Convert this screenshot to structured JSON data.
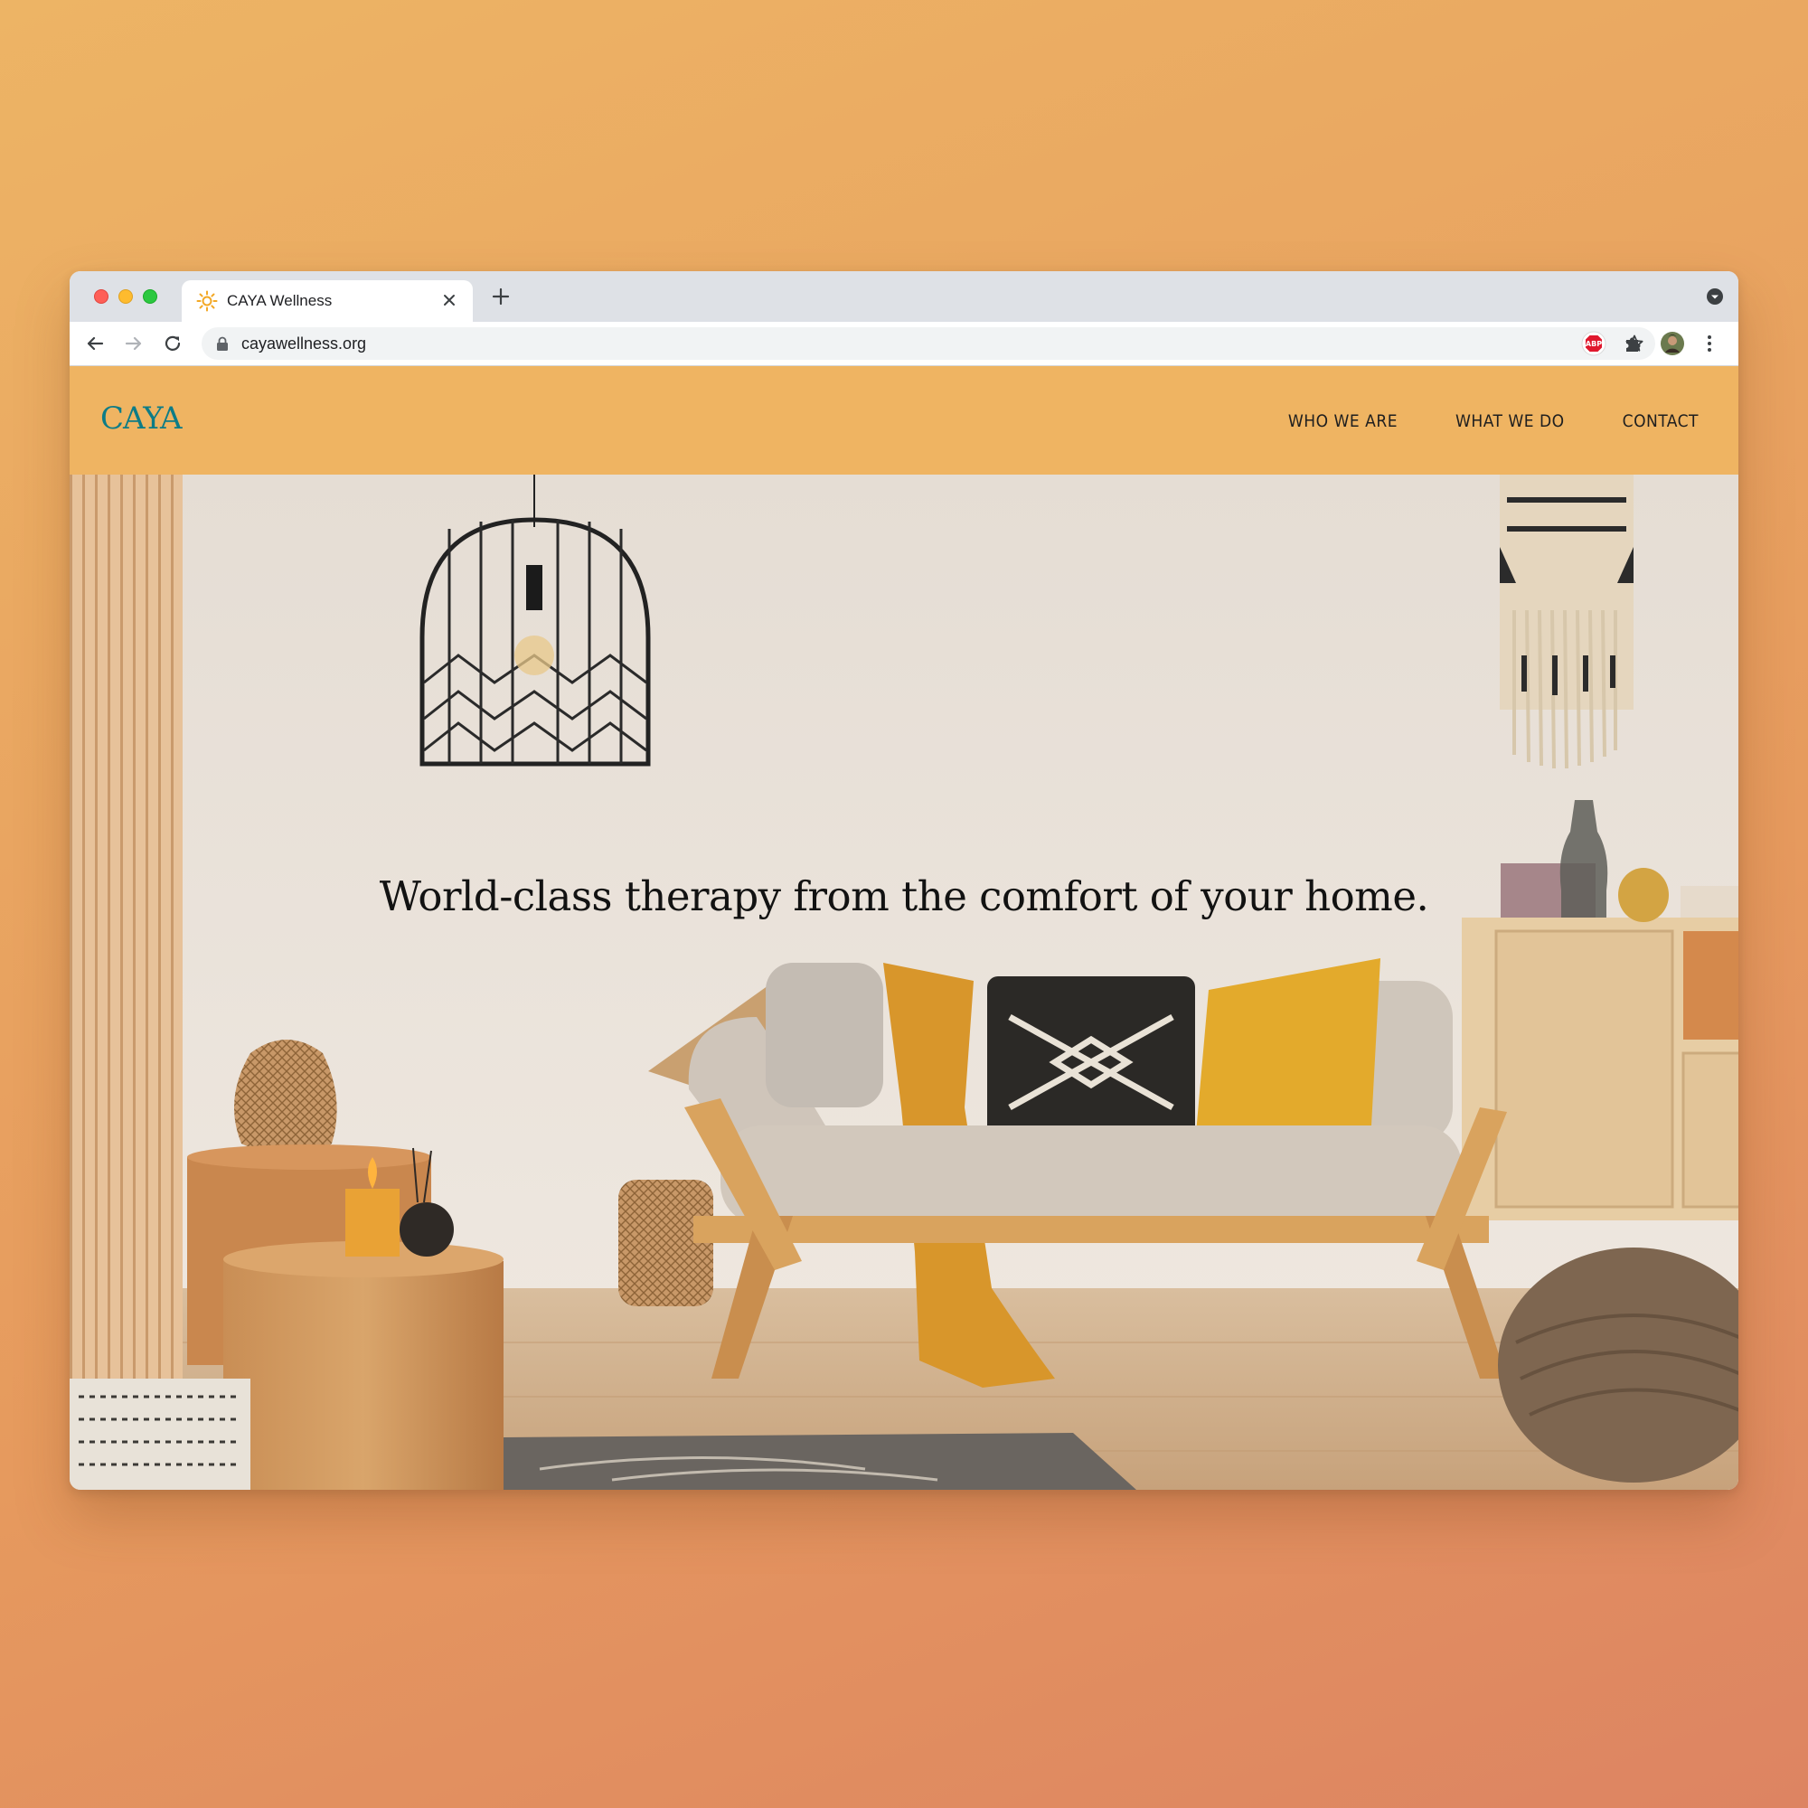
{
  "browser": {
    "tab": {
      "title": "CAYA Wellness",
      "favicon": "sun-icon"
    },
    "url": "cayawellness.org",
    "extensions": [
      {
        "name": "adblock-plus-icon",
        "label": "ABP",
        "color": "#E0182D"
      },
      {
        "name": "puzzle-extensions-icon"
      },
      {
        "name": "profile-avatar"
      }
    ]
  },
  "site": {
    "logo": "CAYA",
    "nav": [
      "WHO WE ARE",
      "WHAT WE DO",
      "CONTACT"
    ],
    "hero": {
      "headline": "World-class therapy from the comfort of your home."
    },
    "colors": {
      "header_bg": "#EFB462",
      "logo": "#0E7C86",
      "nav_text": "#1F1F1F"
    }
  }
}
